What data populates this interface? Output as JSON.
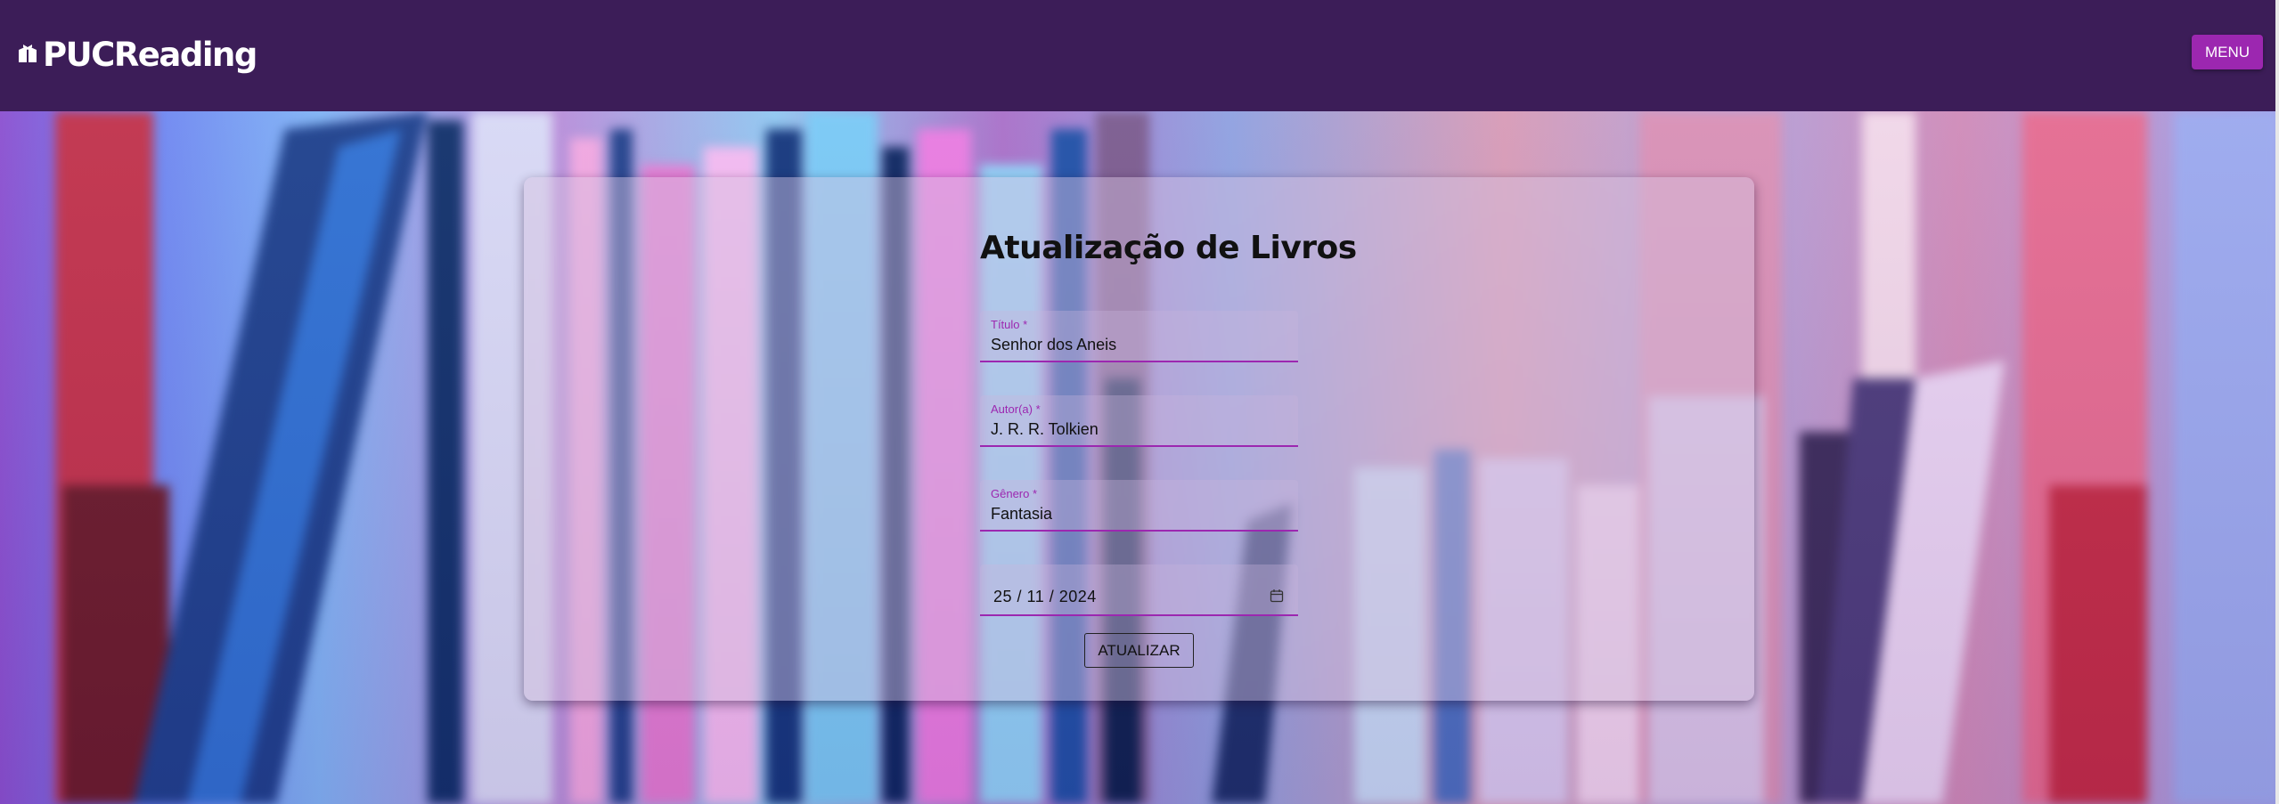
{
  "header": {
    "brand_name": "PUCReading",
    "brand_icon": "book-open-icon",
    "menu_label": "MENU"
  },
  "form": {
    "title": "Atualização de Livros",
    "fields": [
      {
        "label": "Título *",
        "value": "Senhor dos Aneis"
      },
      {
        "label": "Autor(a) *",
        "value": "J. R. R. Tolkien"
      },
      {
        "label": "Gênero *",
        "value": "Fantasia"
      }
    ],
    "date": {
      "value": "25 / 11 / 2024",
      "icon": "calendar-icon"
    },
    "submit_label": "ATUALIZAR"
  },
  "colors": {
    "header_bg": "#3c1d58",
    "accent": "#9c27b0",
    "text": "#111111"
  }
}
